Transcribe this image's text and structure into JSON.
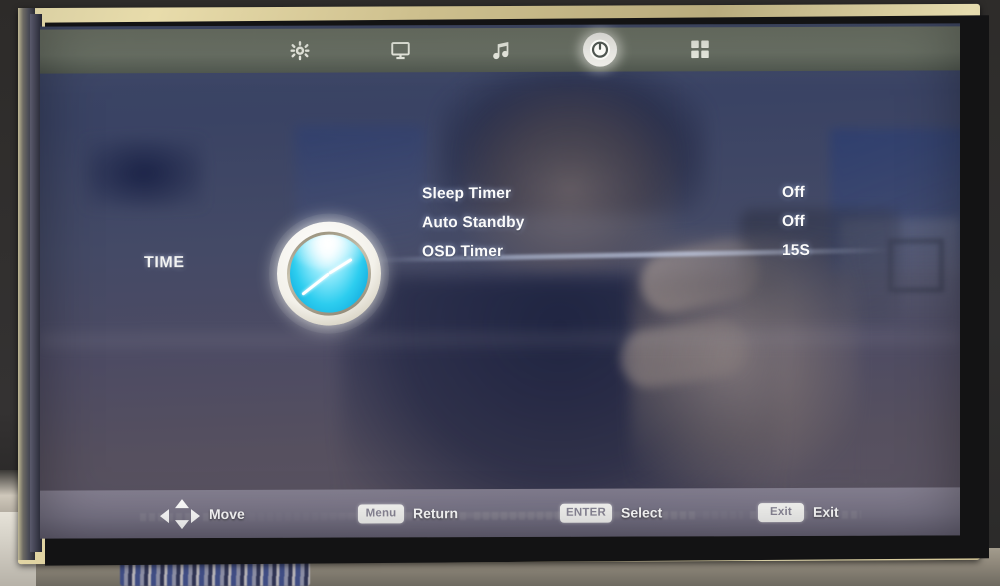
{
  "device": {
    "kind": "tv-osd-menu",
    "bezel_color": "#d6ca9c",
    "screen_bg": "#3f4765"
  },
  "topbar": {
    "tabs": [
      {
        "id": "settings",
        "icon": "gear-icon",
        "label": "Settings",
        "active": false
      },
      {
        "id": "picture",
        "icon": "monitor-icon",
        "label": "Picture",
        "active": false
      },
      {
        "id": "sound",
        "icon": "music-note-icon",
        "label": "Sound",
        "active": false
      },
      {
        "id": "time",
        "icon": "clock-power-icon",
        "label": "Time",
        "active": true
      },
      {
        "id": "option",
        "icon": "grid-icon",
        "label": "Option",
        "active": false
      }
    ]
  },
  "menu": {
    "title": "TIME",
    "icon": "clock-icon",
    "rows": [
      {
        "label": "Sleep Timer",
        "value": "Off"
      },
      {
        "label": "Auto Standby",
        "value": "Off"
      },
      {
        "label": "OSD Timer",
        "value": "15S"
      }
    ]
  },
  "hints": [
    {
      "icon": "dpad-icon",
      "key": "",
      "label": "Move"
    },
    {
      "icon": "key-badge",
      "key": "Menu",
      "label": "Return"
    },
    {
      "icon": "key-badge",
      "key": "ENTER",
      "label": "Select"
    },
    {
      "icon": "key-badge",
      "key": "Exit",
      "label": "Exit"
    }
  ]
}
